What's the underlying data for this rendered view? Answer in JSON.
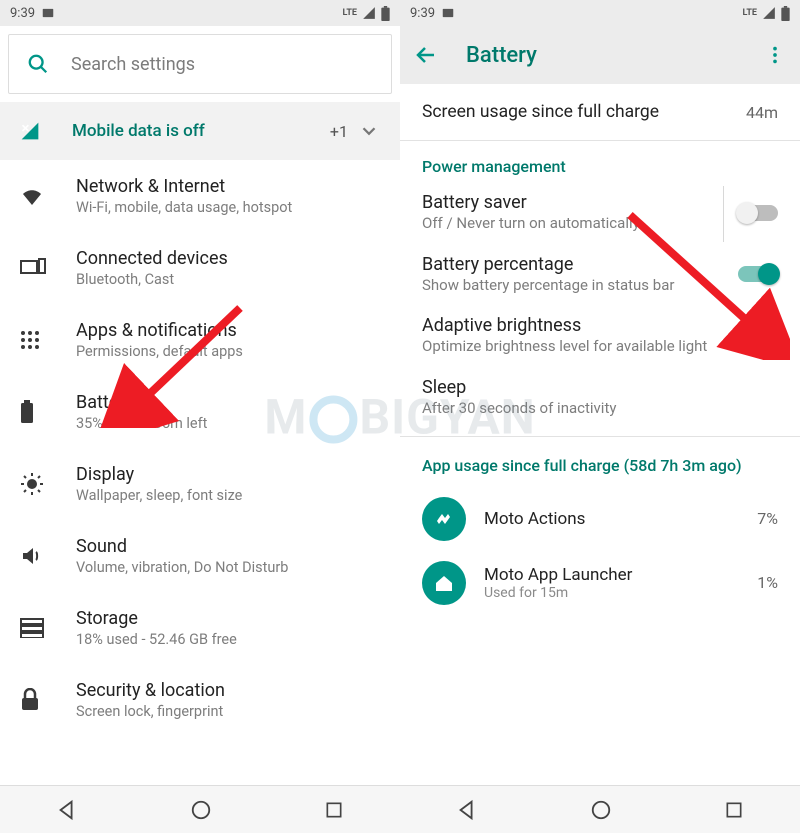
{
  "left": {
    "status": {
      "time": "9:39",
      "network_hint": "LTE"
    },
    "search": {
      "placeholder": "Search settings"
    },
    "banner": {
      "label": "Mobile data is off",
      "extra": "+1"
    },
    "items": [
      {
        "title": "Network & Internet",
        "sub": "Wi-Fi, mobile, data usage, hotspot"
      },
      {
        "title": "Connected devices",
        "sub": "Bluetooth, Cast"
      },
      {
        "title": "Apps & notifications",
        "sub": "Permissions, default apps"
      },
      {
        "title": "Battery",
        "sub": "35% - 7d 9h 35m left"
      },
      {
        "title": "Display",
        "sub": "Wallpaper, sleep, font size"
      },
      {
        "title": "Sound",
        "sub": "Volume, vibration, Do Not Disturb"
      },
      {
        "title": "Storage",
        "sub": "18% used - 52.46 GB free"
      },
      {
        "title": "Security & location",
        "sub": "Screen lock, fingerprint"
      }
    ]
  },
  "right": {
    "status": {
      "time": "9:39",
      "network_hint": "LTE"
    },
    "appbar": {
      "title": "Battery"
    },
    "screen_usage": {
      "label": "Screen usage since full charge",
      "value": "44m"
    },
    "section_power": "Power management",
    "battery_saver": {
      "title": "Battery saver",
      "sub": "Off / Never turn on automatically",
      "on": false
    },
    "battery_percentage": {
      "title": "Battery percentage",
      "sub": "Show battery percentage in status bar",
      "on": true
    },
    "adaptive_brightness": {
      "title": "Adaptive brightness",
      "sub": "Optimize brightness level for available light",
      "on": true
    },
    "sleep": {
      "title": "Sleep",
      "sub": "After 30 seconds of inactivity"
    },
    "section_app_usage": "App usage since full charge (58d 7h 3m ago)",
    "apps": [
      {
        "title": "Moto Actions",
        "sub": "",
        "pct": "7%"
      },
      {
        "title": "Moto App Launcher",
        "sub": "Used for 15m",
        "pct": "1%"
      }
    ]
  },
  "colors": {
    "accent": "#009688",
    "accent_dark": "#00796b",
    "arrow": "#ed1c24"
  },
  "watermark": {
    "prefix": "M",
    "suffix": "BIGYAN"
  }
}
